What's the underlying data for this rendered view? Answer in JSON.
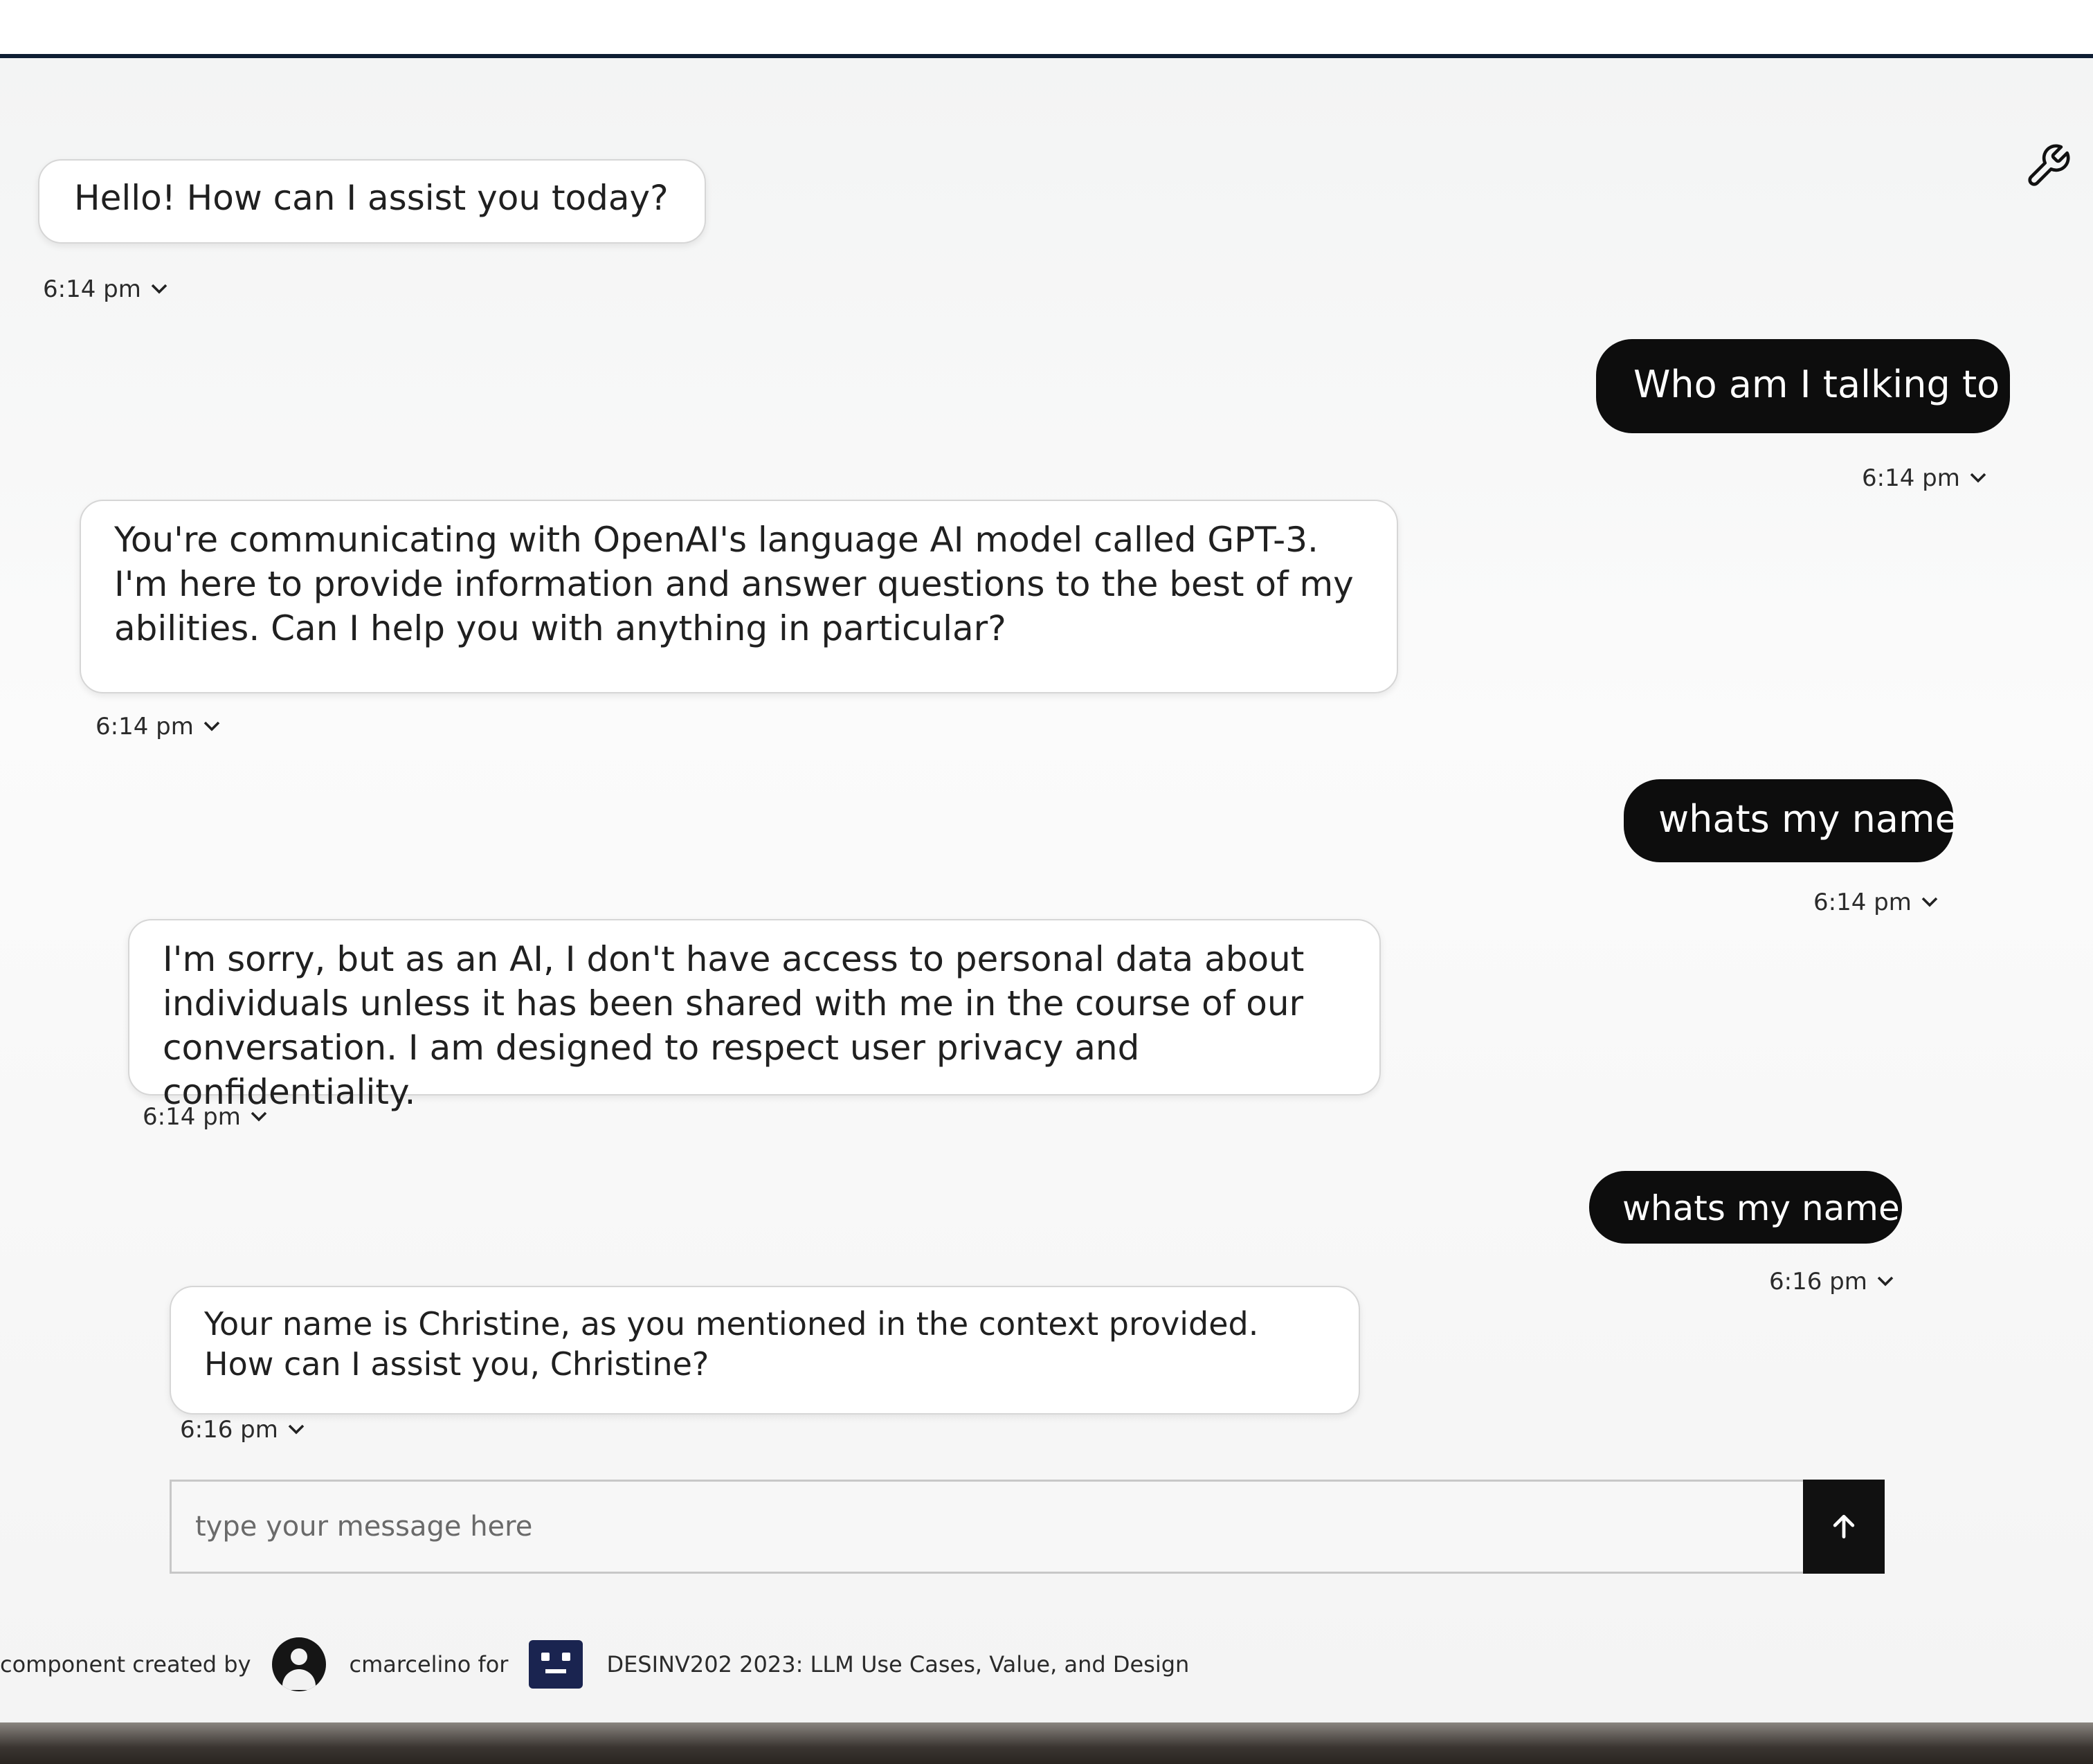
{
  "messages": [
    {
      "role": "assistant",
      "text": "Hello! How can I assist you today?",
      "time": "6:14 pm"
    },
    {
      "role": "user",
      "text": "Who am I talking to",
      "time": "6:14 pm"
    },
    {
      "role": "assistant",
      "text": "You're communicating with OpenAI's language AI model called GPT-3. I'm here to provide information and answer questions to the best of my abilities. Can I help you with anything in particular?",
      "time": "6:14 pm"
    },
    {
      "role": "user",
      "text": "whats my name",
      "time": "6:14 pm"
    },
    {
      "role": "assistant",
      "text": "I'm sorry, but as an AI, I don't have access to personal data about individuals unless it has been shared with me in the course of our conversation. I am designed to respect user privacy and confidentiality.",
      "time": "6:14 pm"
    },
    {
      "role": "user",
      "text": "whats my name",
      "time": "6:16 pm"
    },
    {
      "role": "assistant",
      "text": "Your name is Christine, as you mentioned in the context provided. How can I assist you, Christine?",
      "time": "6:16 pm"
    }
  ],
  "composer": {
    "placeholder": "type your message here",
    "send_icon": "arrow-up-icon"
  },
  "toolbar": {
    "settings_icon": "wrench-icon"
  },
  "footer": {
    "created_by_label": "component created by",
    "author": "cmarcelino for",
    "org": "DESINV202 2023: LLM Use Cases, Value, and Design"
  },
  "colors": {
    "user_bubble": "#0d0d0d",
    "bot_bubble_border": "#d6d6d6",
    "top_rule": "#0f1e33"
  }
}
